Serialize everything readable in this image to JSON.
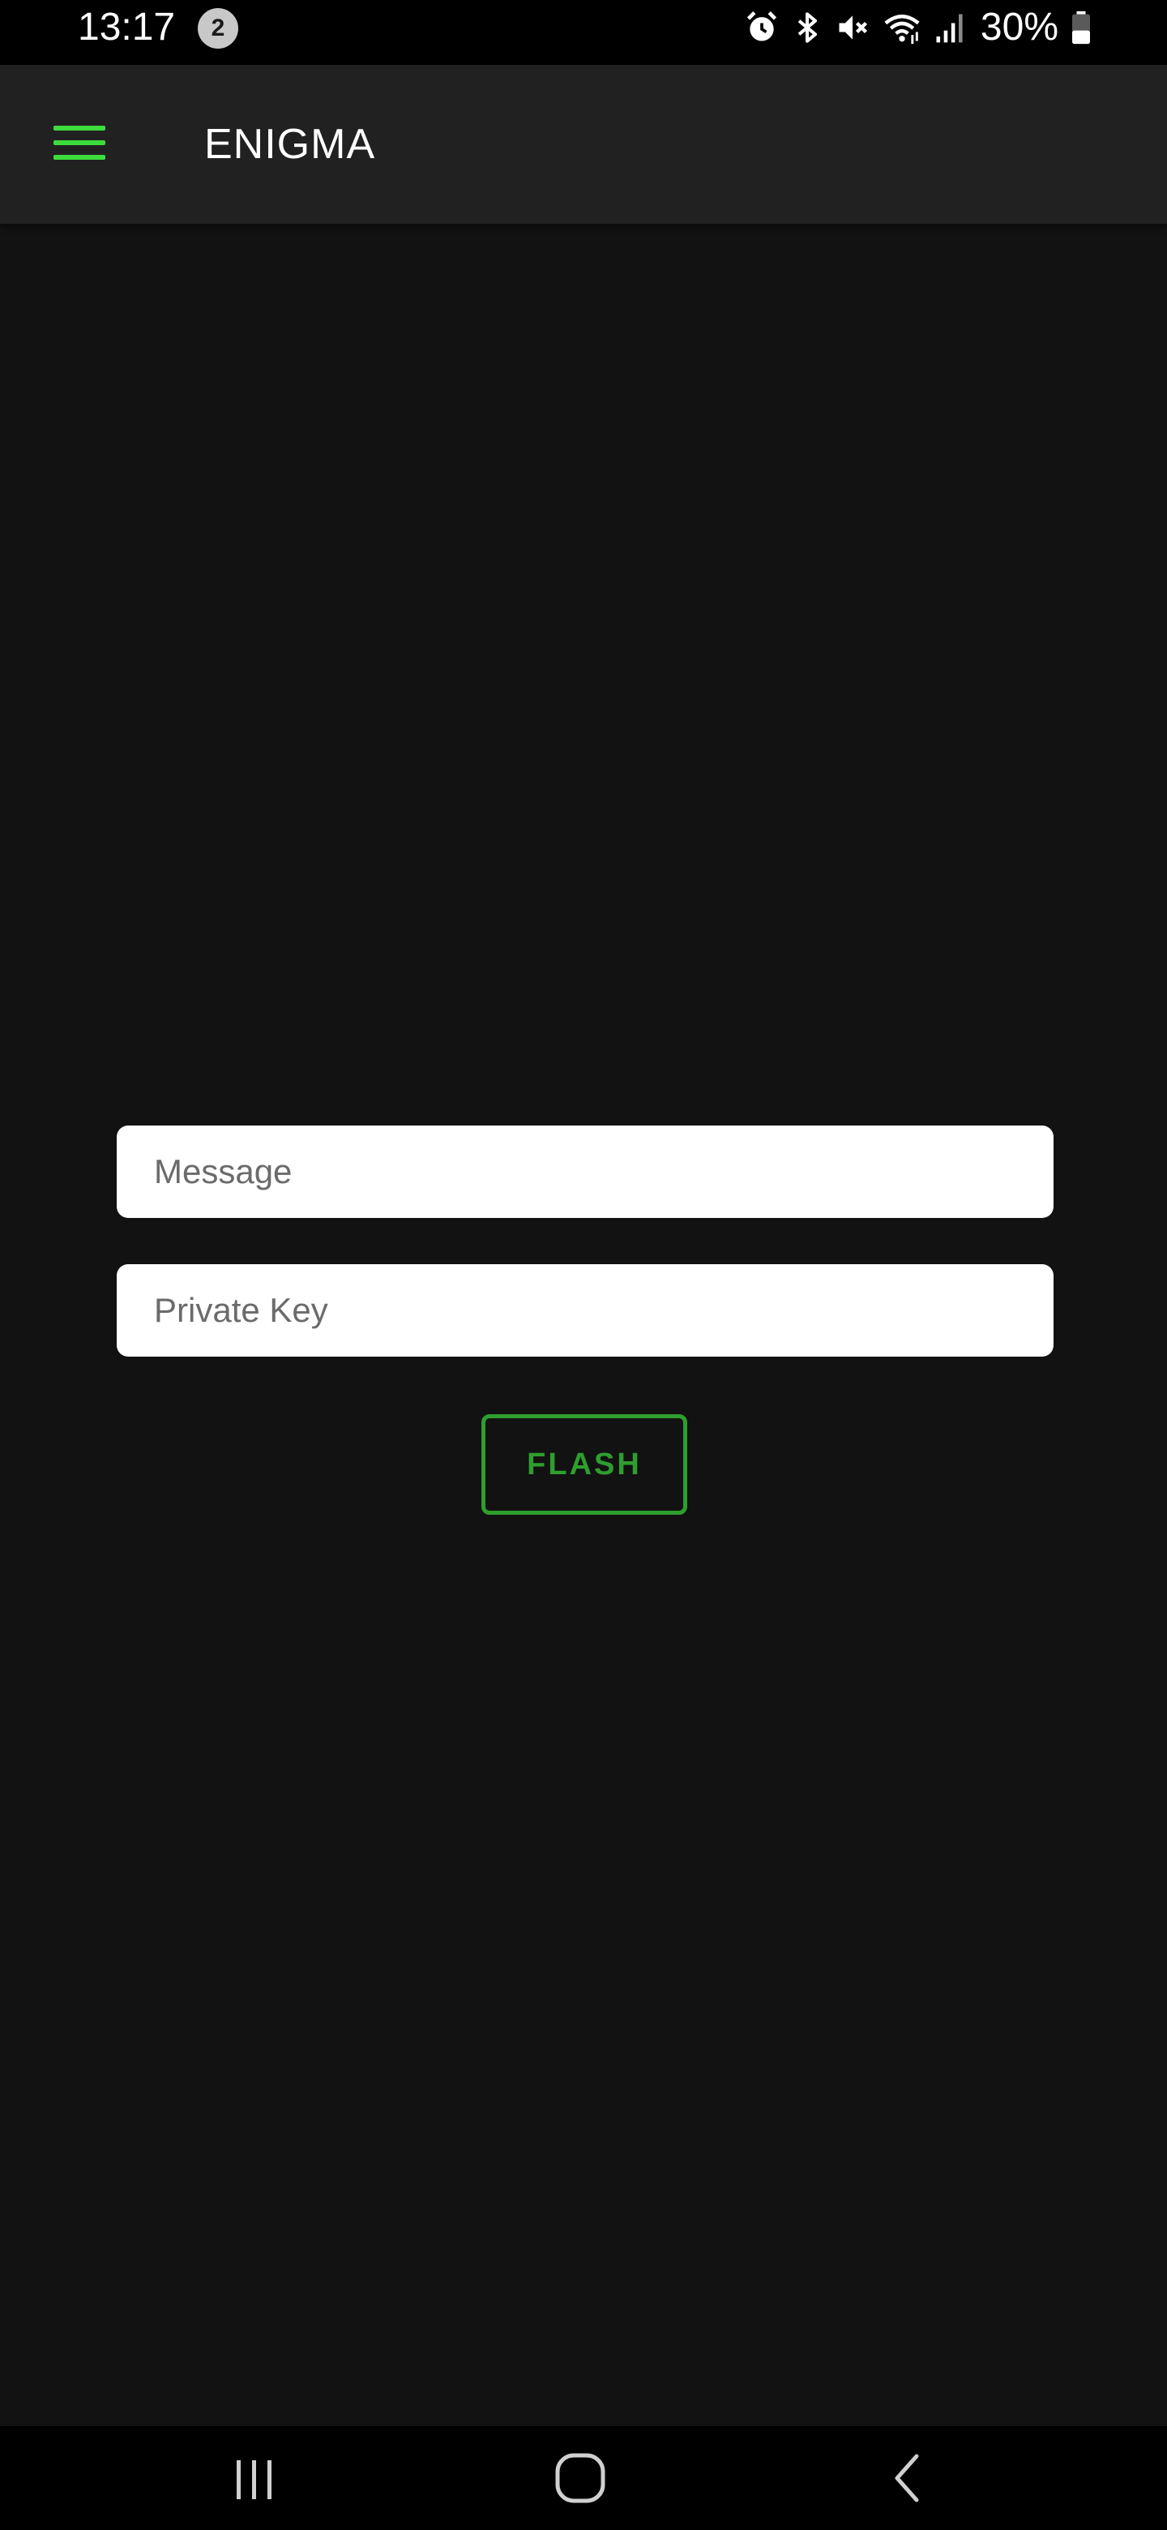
{
  "status_bar": {
    "time": "13:17",
    "notification_count": "2",
    "battery": "30%",
    "icons": [
      "alarm-icon",
      "bluetooth-icon",
      "mute-icon",
      "wifi-icon",
      "signal-icon",
      "battery-icon"
    ]
  },
  "app_bar": {
    "title": "ENIGMA",
    "menu_icon": "hamburger-menu-icon",
    "accent_color": "#3ddc3d"
  },
  "form": {
    "message_placeholder": "Message",
    "message_value": "",
    "key_placeholder": "Private Key",
    "key_value": "",
    "button_label": "FLASH",
    "button_color": "#2e9e2e"
  },
  "nav_bar": {
    "items": [
      "recents-icon",
      "home-icon",
      "back-icon"
    ]
  },
  "colors": {
    "background": "#121212",
    "app_bar": "#212121",
    "field_background": "#ffffff"
  }
}
